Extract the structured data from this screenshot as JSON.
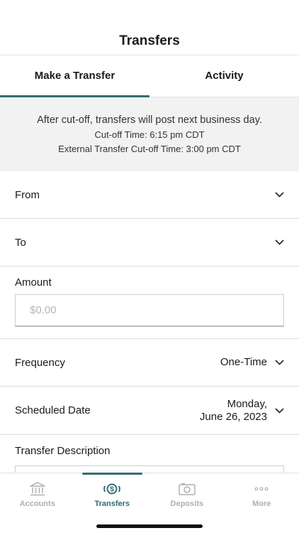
{
  "header": {
    "title": "Transfers"
  },
  "tabs": [
    {
      "label": "Make a Transfer",
      "active": true
    },
    {
      "label": "Activity",
      "active": false
    }
  ],
  "notice": {
    "line1": "After cut-off, transfers will post next business day.",
    "line2": "Cut-off Time: 6:15 pm CDT",
    "line3": "External Transfer Cut-off Time: 3:00 pm CDT"
  },
  "form": {
    "from_label": "From",
    "to_label": "To",
    "amount_label": "Amount",
    "amount_placeholder": "$0.00",
    "frequency_label": "Frequency",
    "frequency_value": "One-Time",
    "date_label": "Scheduled Date",
    "date_line1": "Monday,",
    "date_line2": "June 26, 2023",
    "description_label": "Transfer Description"
  },
  "tabbar": {
    "items": [
      {
        "label": "Accounts",
        "icon": "bank-icon"
      },
      {
        "label": "Transfers",
        "icon": "transfer-dollar-icon"
      },
      {
        "label": "Deposits",
        "icon": "camera-icon"
      },
      {
        "label": "More",
        "icon": "more-dots-icon"
      }
    ],
    "active": "Transfers"
  },
  "colors": {
    "accent": "#2f6e73",
    "inactive": "#b0b0b0",
    "notice_bg": "#f2f2f2"
  }
}
